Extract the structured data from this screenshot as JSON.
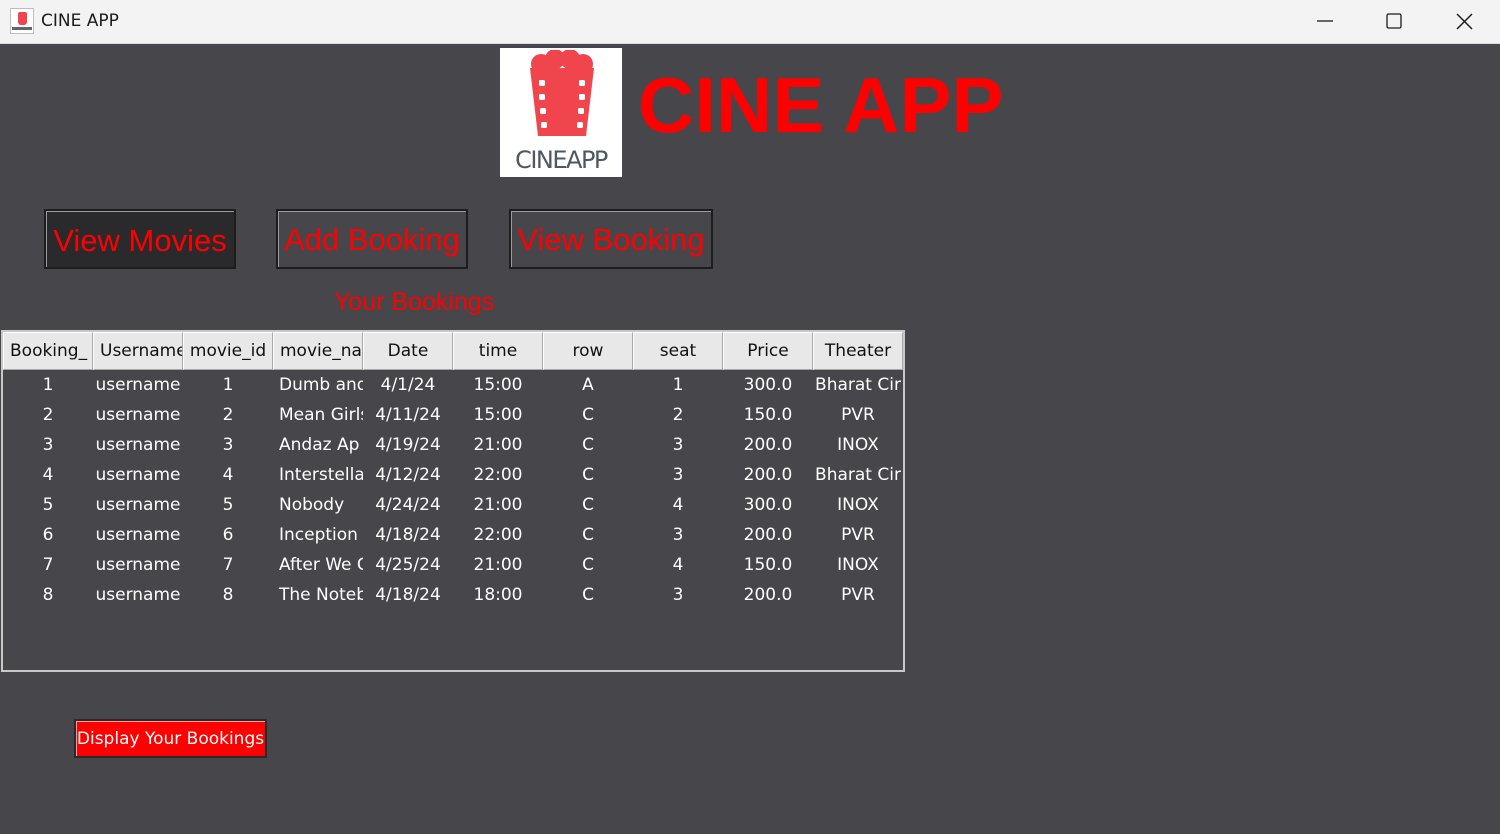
{
  "window": {
    "title": "CINE APP"
  },
  "logo": {
    "text": "CINEAPP"
  },
  "header": {
    "title": "CINE APP"
  },
  "nav": {
    "view_movies": "View Movies",
    "add_booking": "Add Booking",
    "view_booking": "View Booking"
  },
  "section": {
    "label": "Your Bookings"
  },
  "table": {
    "columns": [
      "Booking_",
      "Username",
      "movie_id",
      "movie_na",
      "Date",
      "time",
      "row",
      "seat",
      "Price",
      "Theater"
    ],
    "rows": [
      [
        "1",
        "username",
        "1",
        "Dumb and",
        "4/1/24",
        "15:00",
        "A",
        "1",
        "300.0",
        "Bharat Cir"
      ],
      [
        "2",
        "username",
        "2",
        "Mean Girls",
        "4/11/24",
        "15:00",
        "C",
        "2",
        "150.0",
        "PVR"
      ],
      [
        "3",
        "username",
        "3",
        "Andaz Ap",
        "4/19/24",
        "21:00",
        "C",
        "3",
        "200.0",
        "INOX"
      ],
      [
        "4",
        "username",
        "4",
        "Interstellar",
        "4/12/24",
        "22:00",
        "C",
        "3",
        "200.0",
        "Bharat Cir"
      ],
      [
        "5",
        "username",
        "5",
        "Nobody",
        "4/24/24",
        "21:00",
        "C",
        "4",
        "300.0",
        "INOX"
      ],
      [
        "6",
        "username",
        "6",
        "Inception",
        "4/18/24",
        "22:00",
        "C",
        "3",
        "200.0",
        "PVR"
      ],
      [
        "7",
        "username",
        "7",
        "After We C",
        "4/25/24",
        "21:00",
        "C",
        "4",
        "150.0",
        "INOX"
      ],
      [
        "8",
        "username",
        "8",
        "The Notebook",
        "4/18/24",
        "18:00",
        "C",
        "3",
        "200.0",
        "PVR"
      ]
    ]
  },
  "actions": {
    "display_bookings": "Display Your Bookings"
  },
  "icons": {
    "minimize": "minimize-icon",
    "maximize": "maximize-icon",
    "close": "close-icon",
    "popcorn": "popcorn-icon"
  },
  "colors": {
    "accent": "#ff0000",
    "background": "#47464b",
    "popcorn": "#f0454c"
  }
}
